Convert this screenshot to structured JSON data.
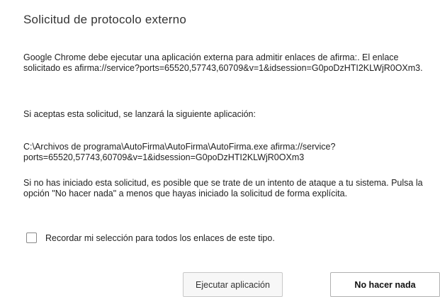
{
  "dialog": {
    "title": "Solicitud de protocolo externo",
    "paragraph1": "Google Chrome debe ejecutar una aplicación externa para admitir enlaces de afirma:. El enlace solicitado es afirma://service?ports=65520,57743,60709&v=1&idsession=G0poDzHTI2KLWjR0OXm3.",
    "paragraph2": "Si aceptas esta solicitud, se lanzará la siguiente aplicación:",
    "paragraph3": "C:\\Archivos de programa\\AutoFirma\\AutoFirma\\AutoFirma.exe afirma://service?ports=65520,57743,60709&v=1&idsession=G0poDzHTI2KLWjR0OXm3",
    "paragraph4": "Si no has iniciado esta solicitud, es posible que se trate de un intento de ataque a tu sistema. Pulsa la opción \"No hacer nada\" a menos que hayas iniciado la solicitud de forma explícita.",
    "remember_label": "Recordar mi selección para todos los enlaces de este tipo.",
    "remember_checked": false,
    "buttons": {
      "run_label": "Ejecutar aplicación",
      "nothing_label": "No hacer nada"
    }
  }
}
